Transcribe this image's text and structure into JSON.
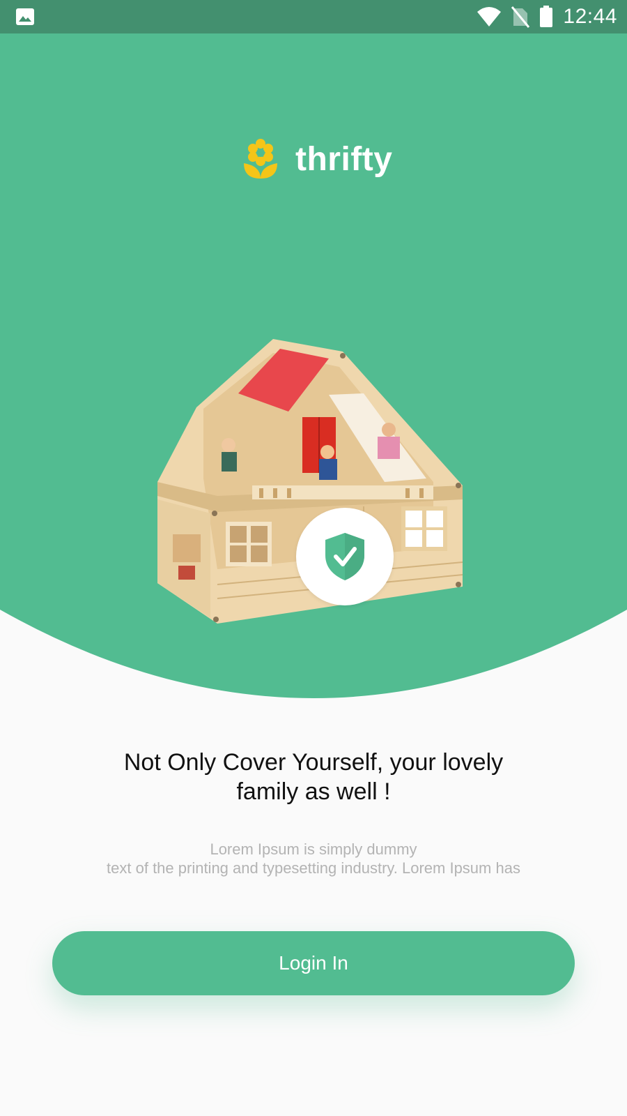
{
  "status_bar": {
    "time": "12:44",
    "icons": [
      "image-icon",
      "wifi-icon",
      "no-sim-icon",
      "battery-icon"
    ]
  },
  "brand": {
    "name": "thrifty",
    "logo_icon": "flower-icon",
    "logo_color": "#f5c518"
  },
  "hero": {
    "background_color": "#52bc91",
    "illustration": "dollhouse-illustration",
    "badge_icon": "shield-check-icon"
  },
  "content": {
    "headline_line1": "Not Only Cover Yourself, your lovely",
    "headline_line2": "family as well !",
    "subtext_line1": "Lorem Ipsum is simply dummy",
    "subtext_line2": "text of the printing and typesetting industry. Lorem Ipsum has"
  },
  "actions": {
    "login_label": "Login In"
  },
  "colors": {
    "accent": "#52bc91",
    "status_bar": "#43906f",
    "background": "#fafafa"
  }
}
